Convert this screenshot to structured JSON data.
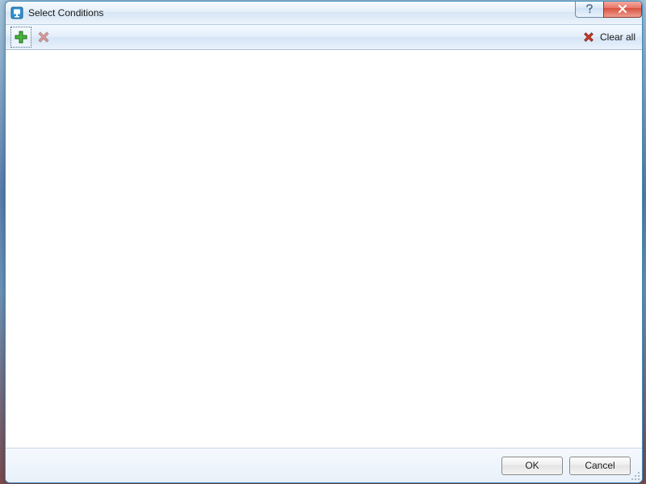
{
  "window": {
    "title": "Select Conditions"
  },
  "toolbar": {
    "clear_all_label": "Clear all"
  },
  "buttons": {
    "ok": "OK",
    "cancel": "Cancel"
  }
}
